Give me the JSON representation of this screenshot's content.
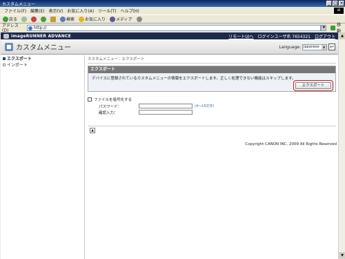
{
  "window": {
    "title": "カスタムメニュー",
    "min": "_",
    "max": "□",
    "close": "×"
  },
  "menubar": [
    "ファイル(F)",
    "編集(E)",
    "表示(V)",
    "お気に入り(A)",
    "ツール(T)",
    "ヘルプ(H)"
  ],
  "toolbar": {
    "back": "戻る",
    "search": "検索",
    "favorites": "お気に入り",
    "media": "メディア"
  },
  "address": {
    "label": "アドレス(D)",
    "value": "http://",
    "go": "移動"
  },
  "brand": {
    "name": "imageRUNNER ADVANCE",
    "remote_ui_link": "リモートUIへ",
    "user_label": "ログインユーザ名 7654321",
    "logout": "ログアウト"
  },
  "page": {
    "title": "カスタムメニュー",
    "language_label": "Language:",
    "language_value": "Japanese"
  },
  "sidebar": {
    "items": [
      {
        "label": "エクスポート",
        "active": true
      },
      {
        "label": "インポート",
        "active": false
      }
    ]
  },
  "content": {
    "breadcrumb": "カスタムメニュー：エクスポート",
    "panel_title": "エクスポート",
    "description": "デバイスに登録されているカスタムメニューの情報をエクスポートします。正しく処理できない機能はスキップします。",
    "export_button": "エクスポート",
    "encrypt_label": "ファイルを暗号化する",
    "password_label": "パスワード：",
    "password_hint": "(4〜16文字)",
    "confirm_label": "確認入力："
  },
  "footer": {
    "copyright": "Copyright CANON INC. 2009 All Rights Reserved"
  },
  "colors": {
    "brand_bar": "#1e2a4a",
    "highlight": "#c02020",
    "panel_head": "#777777"
  }
}
